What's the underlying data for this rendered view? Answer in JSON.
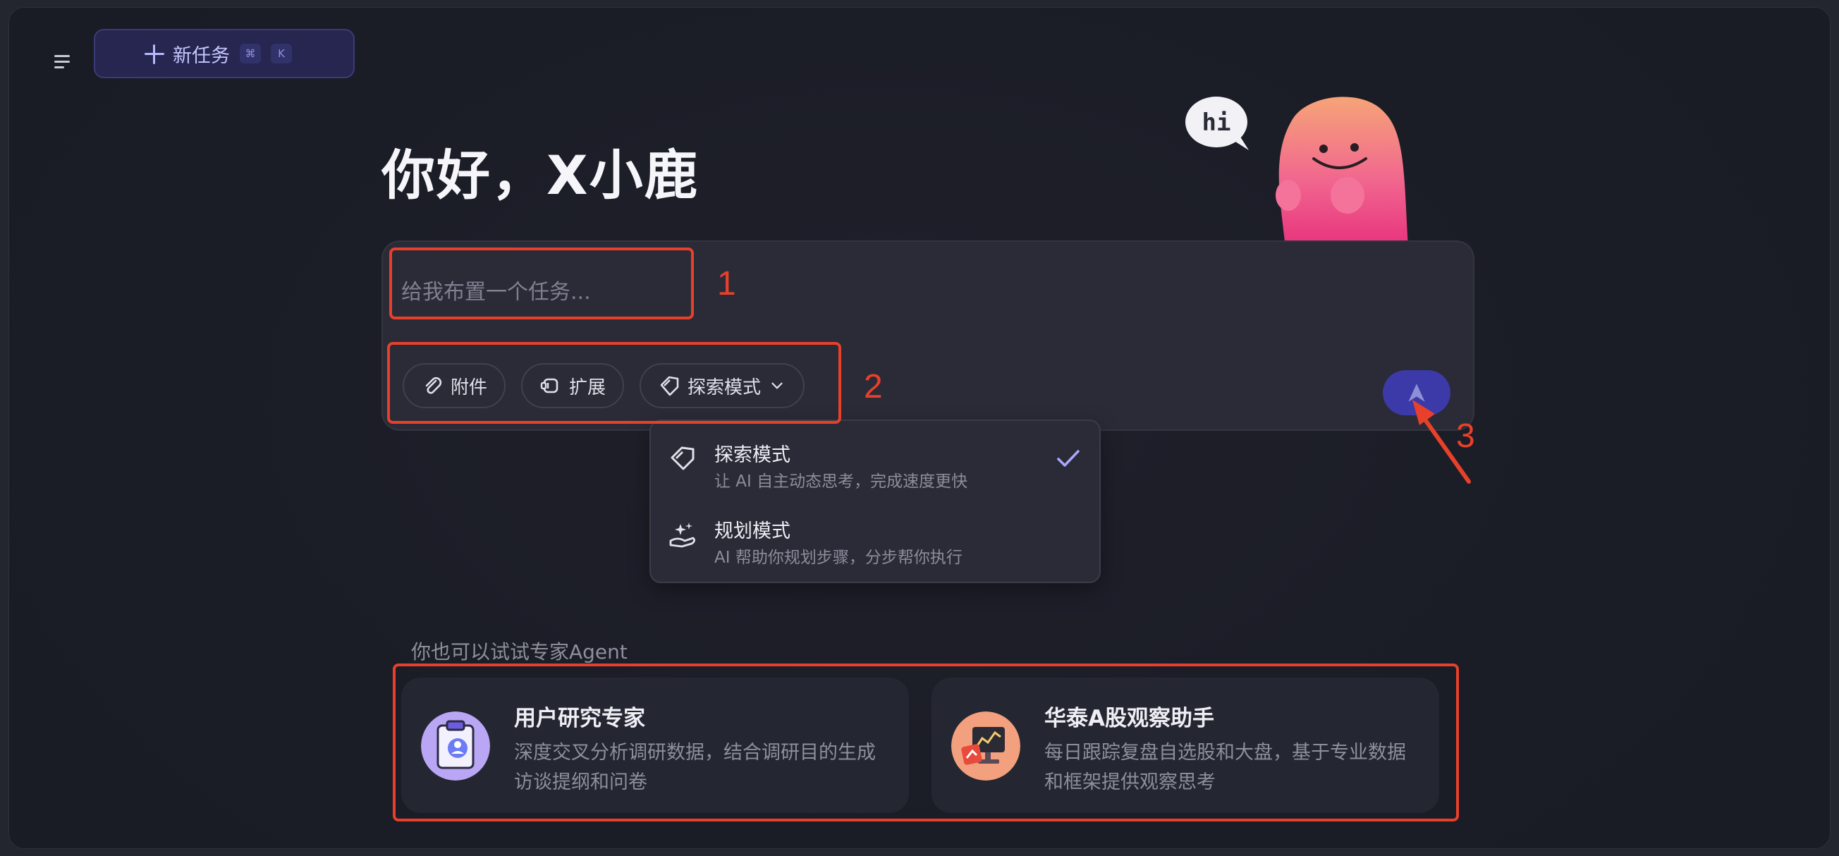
{
  "topbar": {
    "new_task_label": "新任务",
    "shortcut_keys": [
      "⌘",
      "K"
    ]
  },
  "greeting": "你好，X小鹿",
  "mascot": {
    "bubble_text": "hi"
  },
  "input": {
    "placeholder": "给我布置一个任务..."
  },
  "toolbar": {
    "attach_label": "附件",
    "extend_label": "扩展",
    "mode_label": "探索模式"
  },
  "mode_menu": {
    "items": [
      {
        "title": "探索模式",
        "desc": "让 AI 自主动态思考，完成速度更快",
        "selected": true
      },
      {
        "title": "规划模式",
        "desc": "AI 帮助你规划步骤，分步帮你执行",
        "selected": false
      }
    ]
  },
  "experts": {
    "label": "你也可以试试专家Agent",
    "cards": [
      {
        "title": "用户研究专家",
        "desc": "深度交叉分析调研数据，结合调研目的生成访谈提纲和问卷"
      },
      {
        "title": "华泰A股观察助手",
        "desc": "每日跟踪复盘自选股和大盘，基于专业数据和框架提供观察思考"
      }
    ]
  },
  "annotations": {
    "n1": "1",
    "n2": "2",
    "n3": "3"
  },
  "colors": {
    "accent": "#3b3aa8",
    "annotation": "#e8402a",
    "background": "#1b1d27"
  }
}
